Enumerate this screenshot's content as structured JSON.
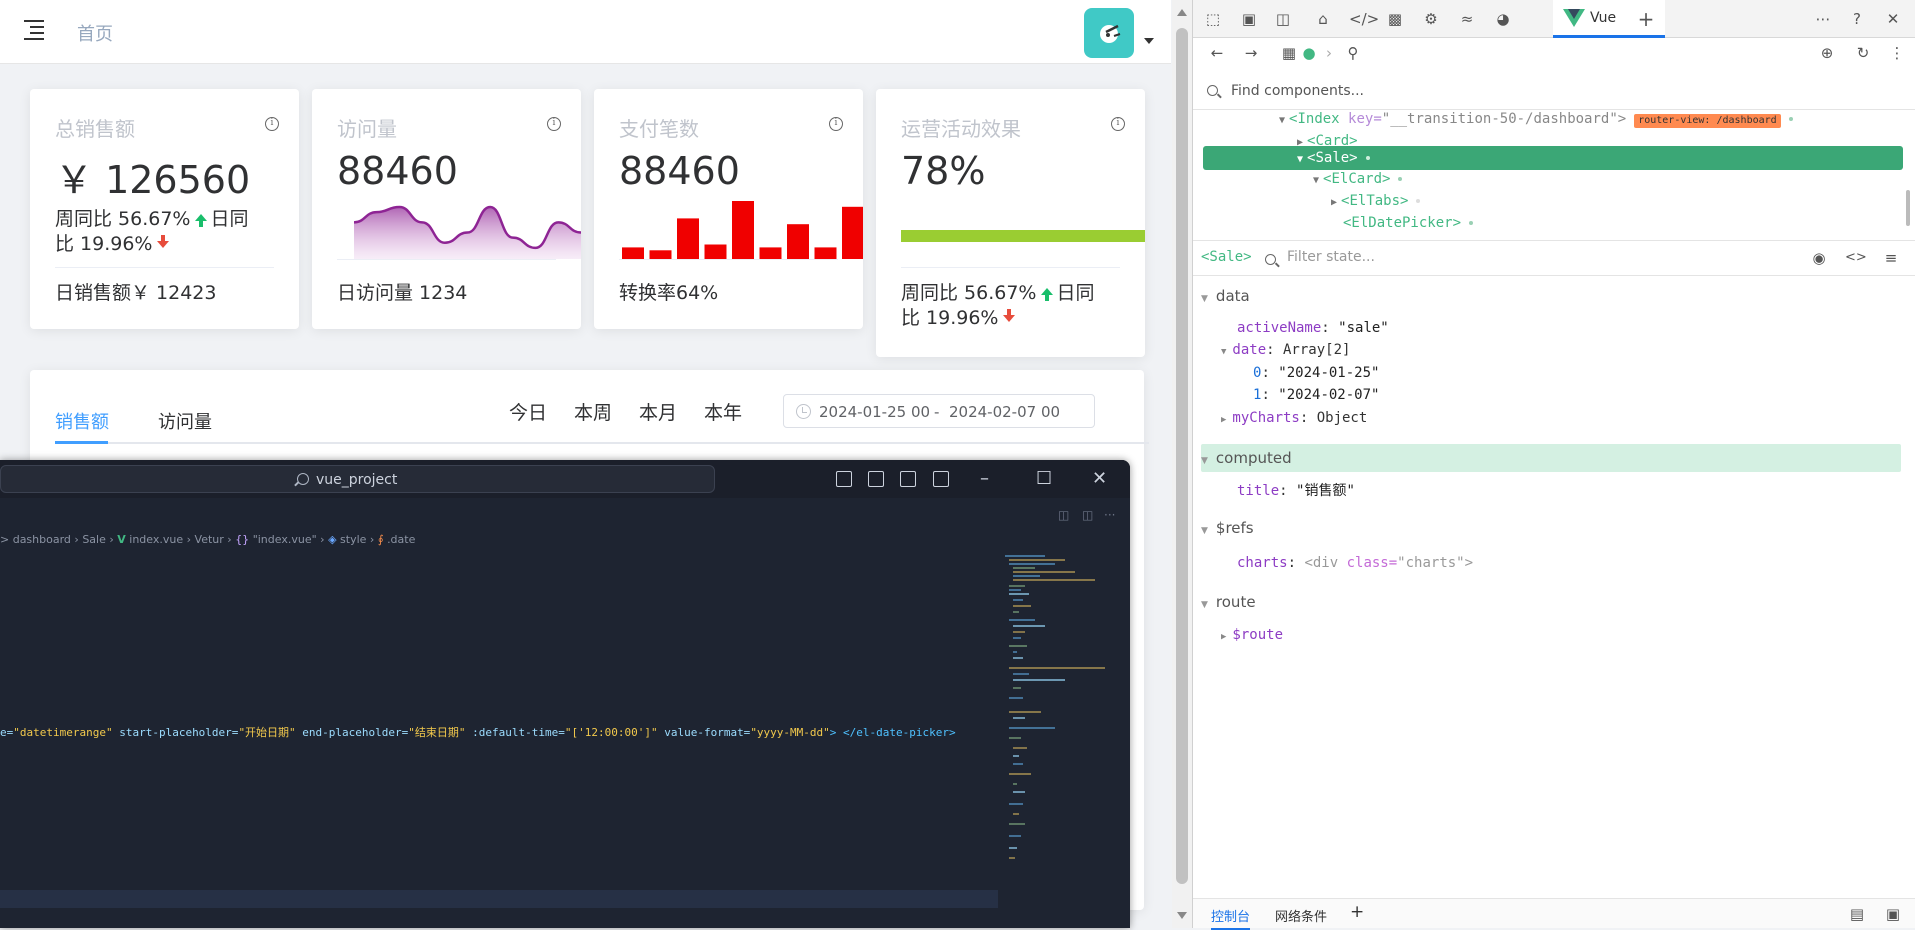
{
  "header": {
    "breadcrumb": "首页"
  },
  "cards": [
    {
      "title": "总销售额",
      "value": "￥ 126560",
      "line1a": "周同比 56.67%",
      "line1b": "日同",
      "line2": "比 19.96%",
      "footer": "日销售额￥ 12423"
    },
    {
      "title": "访问量",
      "value": "88460",
      "footer": "日访问量 1234",
      "sparkline": [
        6,
        8,
        9,
        6,
        2,
        4,
        9,
        3,
        1,
        6,
        4
      ]
    },
    {
      "title": "支付笔数",
      "value": "88460",
      "footer": "转换率64%",
      "bars": [
        2,
        1.5,
        7,
        2.5,
        10,
        2,
        6,
        2,
        9
      ]
    },
    {
      "title": "运营活动效果",
      "value": "78%",
      "progress": 1.0,
      "line1a": "周同比 56.67%",
      "line1b": "日同",
      "line2": "比 19.96%"
    }
  ],
  "sales_panel": {
    "tabs": [
      "销售额",
      "访问量"
    ],
    "periods": [
      "今日",
      "本周",
      "本月",
      "本年"
    ],
    "date_start": "2024-01-25 00",
    "date_sep": "-",
    "date_end": "2024-02-07 00"
  },
  "vscode": {
    "search": "vue_project",
    "breadcrumb": {
      "a": "> dashboard",
      "b": "Sale",
      "c": "index.vue",
      "d": "Vetur",
      "e": "\"index.vue\"",
      "f": "style",
      "g": ".date"
    },
    "code": {
      "p1": "e=",
      "v1": "\"datetimerange\"",
      "p2": " start-placeholder=",
      "v2": "\"开始日期\"",
      "p3": " end-placeholder=",
      "v3": "\"结束日期\"",
      "p4": " :default-time=",
      "v4": "\"['12:00:00']\"",
      "p5": " value-format=",
      "v5": "\"yyyy-MM-dd\"",
      "p6": "> </el-date-picker>"
    }
  },
  "devtools": {
    "vue_tab": "Vue",
    "find_placeholder": "Find components...",
    "tree": {
      "index_tag": "<Index",
      "index_key": " key=",
      "index_val": "\"__transition-50-/dashboard\">",
      "router_badge": "router-view: /dashboard",
      "card": "<Card>",
      "sale": "<Sale>",
      "elcard": "<ElCard>",
      "eltabs": "<ElTabs>",
      "eldatepicker": "<ElDatePicker>"
    },
    "state_component": "<Sale>",
    "filter_placeholder": "Filter state...",
    "sections": {
      "data": "data",
      "computed": "computed",
      "refs": "$refs",
      "route": "route"
    },
    "data": {
      "activeName_key": "activeName",
      "activeName_val": "\"sale\"",
      "date_key": "date",
      "date_type": "Array[2]",
      "date0_idx": "0",
      "date0_val": "\"2024-01-25\"",
      "date1_idx": "1",
      "date1_val": "\"2024-02-07\"",
      "myCharts_key": "myCharts",
      "myCharts_val": "Object"
    },
    "computed": {
      "title_key": "title",
      "title_val": "\"销售额\""
    },
    "refs": {
      "charts_key": "charts",
      "charts_a": "<div ",
      "charts_b": "class=",
      "charts_c": "\"charts\">"
    },
    "route": {
      "route_key": "$route"
    },
    "bottom_tabs": [
      "控制台",
      "网络条件"
    ]
  }
}
